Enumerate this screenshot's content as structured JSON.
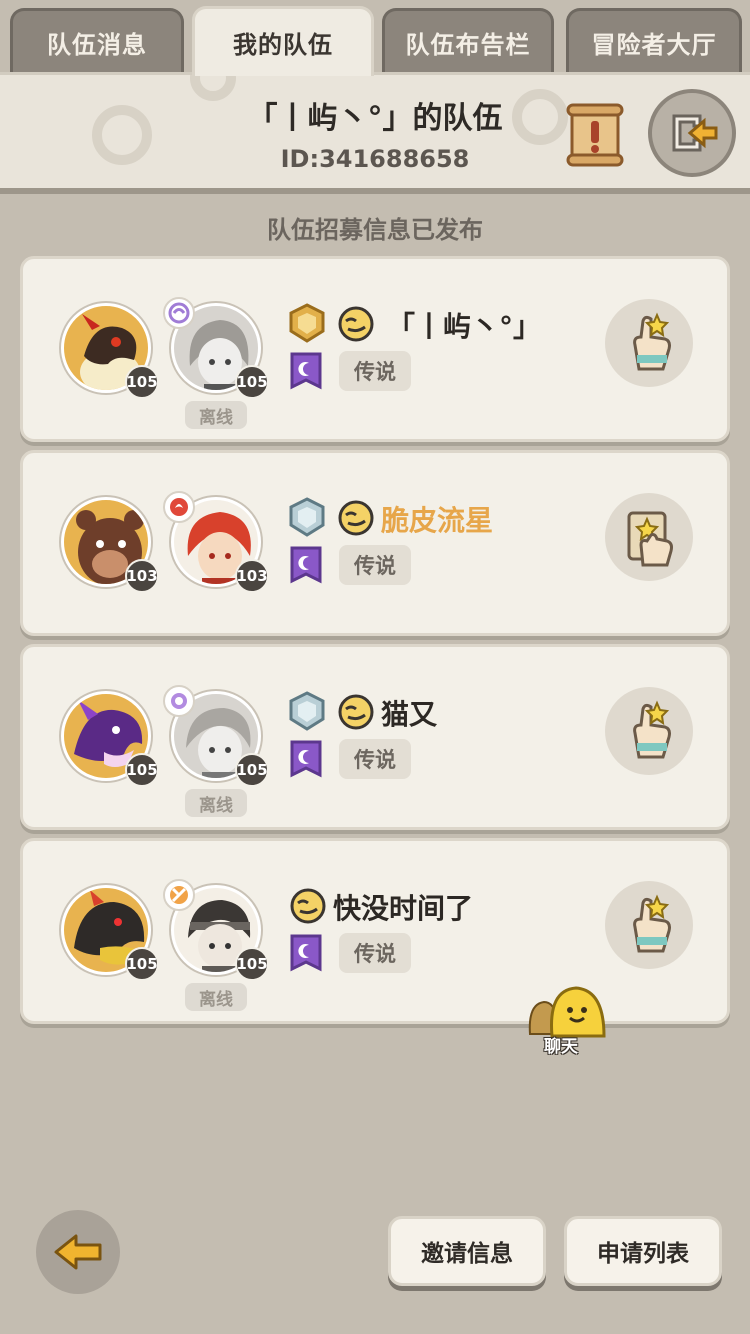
{
  "tabs": [
    {
      "label": "队伍消息"
    },
    {
      "label": "我的队伍"
    },
    {
      "label": "队伍布告栏"
    },
    {
      "label": "冒险者大厅"
    }
  ],
  "header": {
    "team_title": "「丨屿丶°」的队伍",
    "team_id": "ID:341688658",
    "scroll_icon": "scroll-alert-icon",
    "exit_icon": "exit-arrow-icon"
  },
  "subtitle": "队伍招募信息已发布",
  "members": [
    {
      "pet_level": "105",
      "hero_level": "105",
      "hero_offline": "离线",
      "rank": "gold",
      "name": "「丨屿丶°」",
      "name_color": "#2c2824",
      "tier": "传说",
      "action_icon": "like-hand-icon"
    },
    {
      "pet_level": "103",
      "hero_level": "103",
      "hero_offline": "",
      "rank": "silver",
      "name": "脆皮流星",
      "name_color": "#e7a64a",
      "tier": "传说",
      "action_icon": "like-hand-card-icon"
    },
    {
      "pet_level": "105",
      "hero_level": "105",
      "hero_offline": "离线",
      "rank": "silver",
      "name": "猫又",
      "name_color": "#2c2824",
      "tier": "传说",
      "action_icon": "like-hand-icon"
    },
    {
      "pet_level": "105",
      "hero_level": "105",
      "hero_offline": "离线",
      "rank": "none",
      "name": "快没时间了",
      "name_color": "#2c2824",
      "tier": "传说",
      "action_icon": "like-hand-icon"
    }
  ],
  "chat": {
    "label": "聊天"
  },
  "bottom": {
    "invite_label": "邀请信息",
    "apply_label": "申请列表"
  },
  "colors": {
    "background": "#c4bdb1",
    "card": "#f3f0e8",
    "gold_name": "#e7a64a",
    "level_badge": "#4a4540"
  }
}
